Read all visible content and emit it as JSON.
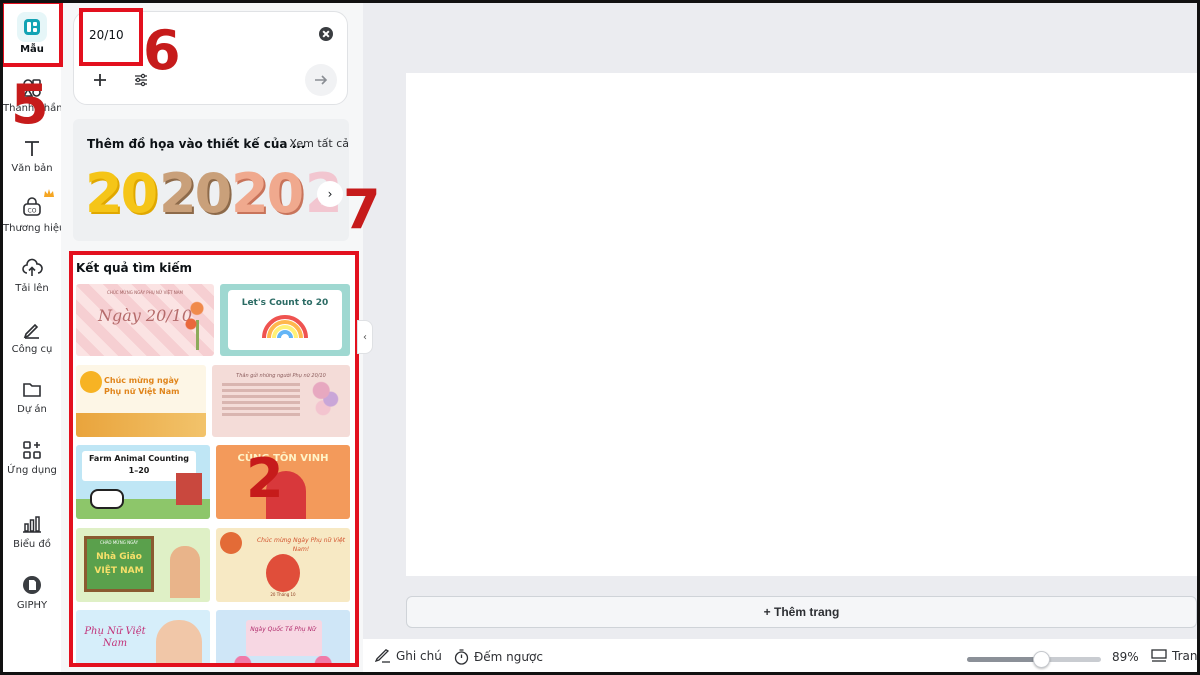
{
  "rail": {
    "items": [
      {
        "label": "Mẫu",
        "icon": "templates-icon"
      },
      {
        "label": "Thành phần",
        "icon": "elements-icon"
      },
      {
        "label": "Văn bản",
        "icon": "text-icon"
      },
      {
        "label": "Thương hiệu",
        "icon": "brand-icon"
      },
      {
        "label": "Tải lên",
        "icon": "upload-icon"
      },
      {
        "label": "Công cụ",
        "icon": "tools-icon"
      },
      {
        "label": "Dự án",
        "icon": "folder-icon"
      },
      {
        "label": "Ứng dụng",
        "icon": "apps-icon"
      },
      {
        "label": "Biểu đồ",
        "icon": "chart-icon"
      },
      {
        "label": "GIPHY",
        "icon": "giphy-icon"
      }
    ]
  },
  "search": {
    "value": "20/10"
  },
  "graphics": {
    "title": "Thêm đồ họa vào thiết kế của ...",
    "see_all": "Xem tất cả",
    "samples": [
      "20",
      "20",
      "20",
      "2"
    ]
  },
  "results": {
    "title": "Kết quả tìm kiếm",
    "templates": [
      {
        "text": "Ngày 20/10",
        "sub": "CHÚC MỪNG NGÀY PHỤ NỮ VIỆT NAM"
      },
      {
        "text": "Let's Count to 20"
      },
      {
        "text": "Chúc mừng ngày Phụ nữ Việt Nam"
      },
      {
        "text": "Thân gửi những người Phụ nữ 20/10"
      },
      {
        "text": "Farm Animal Counting 1–20"
      },
      {
        "text": "CÙNG TÔN VINH"
      },
      {
        "text": "Nhà Giáo VIỆT NAM",
        "sub": "CHÀO MỪNG NGÀY"
      },
      {
        "text": "Chúc mừng Ngày Phụ nữ Việt Nam!",
        "sub": "20 Tháng 10"
      },
      {
        "text": "Phụ Nữ Việt Nam"
      },
      {
        "text": "Ngày Quốc Tế Phụ Nữ"
      }
    ]
  },
  "canvas": {
    "add_page_label": "+ Thêm trang"
  },
  "bottom": {
    "notes_label": "Ghi chú",
    "timer_label": "Đếm ngược",
    "zoom_value": "89%",
    "zoom_fraction": 0.55,
    "pages_label": "Trang"
  },
  "annotations": {
    "m5": "5",
    "m6": "6",
    "m7": "7",
    "m2": "2"
  },
  "colors": {
    "accent": "#e3101e",
    "marker": "#c61b1b",
    "active_rail": "#e6f6f8"
  }
}
